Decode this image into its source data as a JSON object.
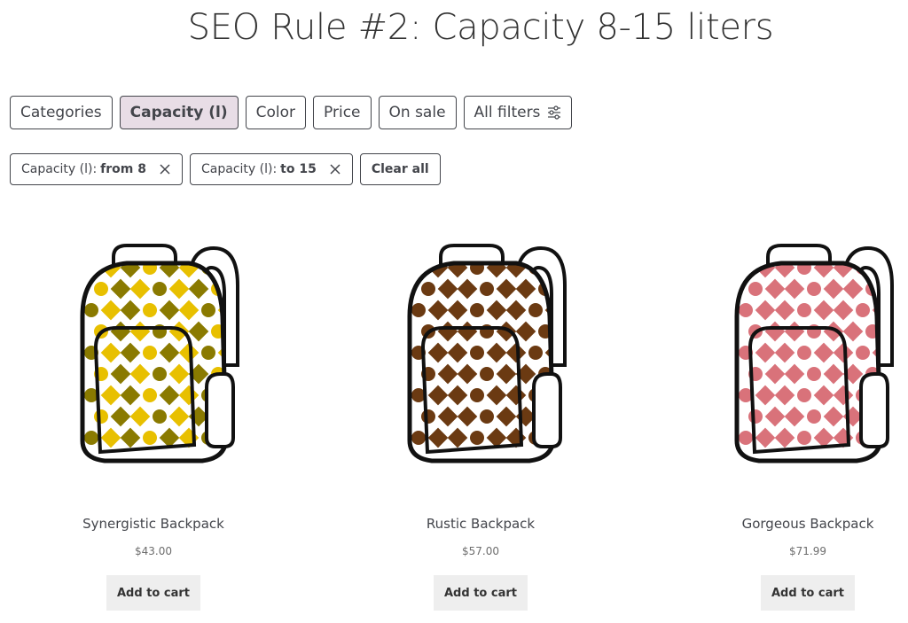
{
  "page": {
    "title": "SEO Rule #2: Capacity 8-15 liters"
  },
  "filters": {
    "buttons": [
      {
        "label": "Categories"
      },
      {
        "label": "Capacity (l)"
      },
      {
        "label": "Color"
      },
      {
        "label": "Price"
      },
      {
        "label": "On sale"
      },
      {
        "label": "All filters"
      }
    ],
    "active_filter": "Capacity (l)"
  },
  "active_filters": {
    "items": [
      {
        "prefix": "Capacity (l):",
        "value": "from 8"
      },
      {
        "prefix": "Capacity (l):",
        "value": "to 15"
      }
    ],
    "clear_label": "Clear all"
  },
  "products": [
    {
      "name": "Synergistic Backpack",
      "price": "$43.00",
      "cta": "Add to cart",
      "pattern_color": "#e8c000",
      "pattern_color_2": "#8a7a00"
    },
    {
      "name": "Rustic Backpack",
      "price": "$57.00",
      "cta": "Add to cart",
      "pattern_color": "#6b3a12",
      "pattern_color_2": "#6b3a12"
    },
    {
      "name": "Gorgeous Backpack",
      "price": "$71.99",
      "cta": "Add to cart",
      "pattern_color": "#d9727a",
      "pattern_color_2": "#d9727a"
    }
  ],
  "icons": {
    "all_filters": "sliders-icon",
    "remove": "close-icon"
  }
}
